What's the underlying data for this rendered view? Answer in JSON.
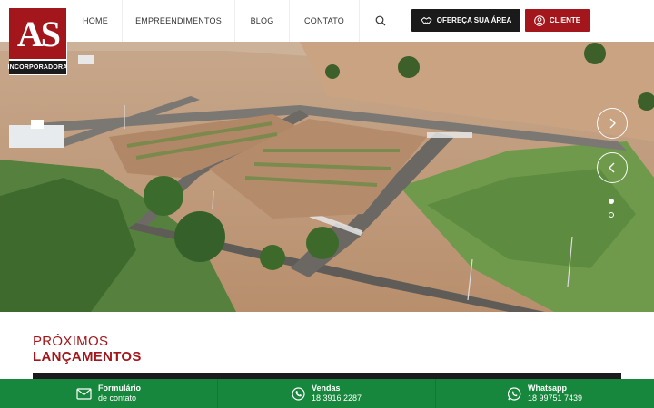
{
  "logo": {
    "mark": "AS",
    "subtitle": "INCORPORADORA"
  },
  "nav": {
    "home": "HOME",
    "empreendimentos": "EMPREENDIMENTOS",
    "blog": "BLOG",
    "contato": "CONTATO"
  },
  "header_buttons": {
    "offer": "OFEREÇA SUA ÁREA",
    "client": "CLIENTE"
  },
  "hero": {
    "slides_total": 2,
    "active_slide": 1
  },
  "section": {
    "title_line1": "PRÓXIMOS",
    "title_line2": "LANÇAMENTOS"
  },
  "bottom_bar": {
    "form": {
      "title": "Formulário",
      "sub": "de contato"
    },
    "sales": {
      "title": "Vendas",
      "sub": "18 3916 2287"
    },
    "whatsapp": {
      "title": "Whatsapp",
      "sub": "18 99751 7439"
    }
  },
  "colors": {
    "brand_red": "#a3161c",
    "dark": "#1b1b1b",
    "green": "#16873c"
  }
}
